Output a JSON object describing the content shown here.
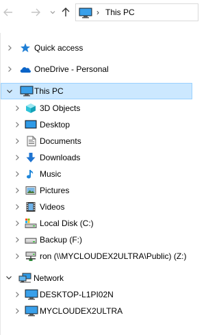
{
  "address_bar": {
    "location": "This PC",
    "separator": "›"
  },
  "tree": {
    "quick_access": "Quick access",
    "onedrive": "OneDrive - Personal",
    "this_pc": "This PC",
    "children": {
      "objects3d": "3D Objects",
      "desktop": "Desktop",
      "documents": "Documents",
      "downloads": "Downloads",
      "music": "Music",
      "pictures": "Pictures",
      "videos": "Videos",
      "local_disk": "Local Disk (C:)",
      "backup": "Backup  (F:)",
      "network_drive": "ron (\\\\MYCLOUDEX2ULTRA\\Public) (Z:)"
    },
    "network": "Network",
    "network_children": {
      "desktop_pc": "DESKTOP-L1PI02N",
      "mycloud": "MYCLOUDEX2ULTRA"
    }
  }
}
